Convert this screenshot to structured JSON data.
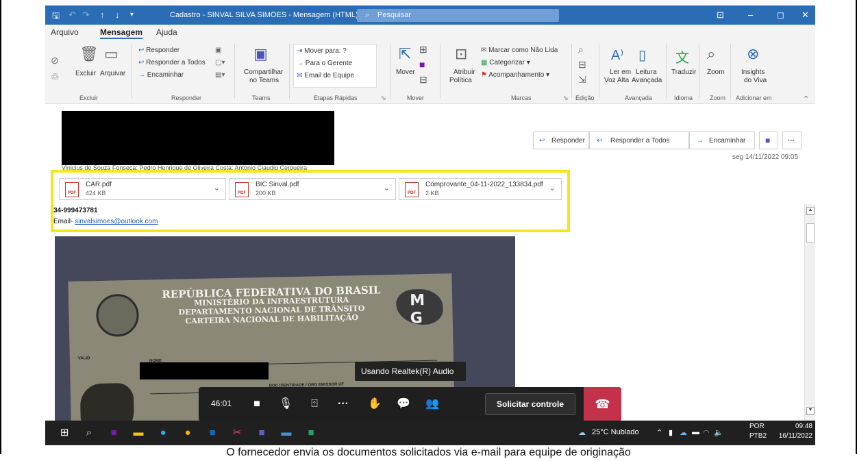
{
  "window": {
    "title": "Cadastro - SINVAL SILVA SIMOES - Mensagem (HTML)",
    "search_placeholder": "Pesquisar"
  },
  "ribbon_tabs": [
    "Arquivo",
    "Mensagem",
    "Ajuda"
  ],
  "ribbon": {
    "excluir": {
      "excluir": "Excluir",
      "arquivar": "Arquivar",
      "group": "Excluir"
    },
    "responder": {
      "responder": "Responder",
      "responder_todos": "Responder a Todos",
      "encaminhar": "Encaminhar",
      "group": "Responder"
    },
    "teams": {
      "compartilhar": "Compartilhar",
      "no_teams": "no Teams",
      "group": "Teams"
    },
    "etapas": {
      "mover_para": "Mover para: ?",
      "para_gerente": "Para o Gerente",
      "email_equipe": "Email de Equipe",
      "group": "Etapas Rápidas"
    },
    "mover": {
      "mover": "Mover",
      "group": "Mover"
    },
    "marcas": {
      "atribuir": "Atribuir",
      "politica": "Política",
      "marcar_nao_lida": "Marcar como Não Lida",
      "categorizar": "Categorizar",
      "acompanhamento": "Acompanhamento",
      "group": "Marcas"
    },
    "edicao": {
      "group": "Edição"
    },
    "avancada": {
      "ler_em": "Ler em",
      "voz_alta": "Voz Alta",
      "leitura": "Leitura",
      "avancada": "Avançada",
      "group": "Avançada"
    },
    "idioma": {
      "traduzir": "Traduzir",
      "group": "Idioma"
    },
    "zoom": {
      "zoom": "Zoom",
      "group": "Zoom"
    },
    "viva": {
      "insights": "Insights",
      "do_viva": "do Viva",
      "group": "Adicionar em"
    }
  },
  "message": {
    "from_line": "Vinicius de Souza Fonseca; Pedro Henrique de Oliveira Costa; Antonio Claudio Cerqueira",
    "actions": {
      "responder": "Responder",
      "responder_todos": "Responder a Todos",
      "encaminhar": "Encaminhar",
      "more": "···"
    },
    "date": "seg 14/11/2022 09:05",
    "attachments": [
      {
        "name": "CAR.pdf",
        "size": "424 KB"
      },
      {
        "name": "BIC Sinval.pdf",
        "size": "200 KB"
      },
      {
        "name": "Comprovante_04-11-2022_133834.pdf",
        "size": "2 KB"
      }
    ],
    "pdf_label": "PDF",
    "phone": "34-999473781",
    "email_label": "Email- ",
    "email": "sinvalsimoes@outlook.com"
  },
  "document_photo": {
    "header_lines": [
      "REPÚBLICA FEDERATIVA DO BRASIL",
      "MINISTÉRIO DA INFRAESTRUTURA",
      "DEPARTAMENTO NACIONAL DE TRÂNSITO",
      "CARTEIRA NACIONAL DE HABILITAÇÃO"
    ],
    "state_m": "M",
    "state_g": "G",
    "field_valid": "VALID",
    "field_nome": "NOME",
    "field_doc": "DOC IDENTIDADE / ORG EMISSOR UF"
  },
  "tooltip": "Usando Realtek(R) Audio",
  "call": {
    "timer": "46:01",
    "request_control": "Solicitar controle"
  },
  "taskbar": {
    "weather": "25°C Nublado",
    "lang_top": "POR",
    "lang_bottom": "PTB2",
    "time": "09:48",
    "date": "16/11/2022"
  },
  "caption": "O fornecedor envia os documentos solicitados via e-mail para equipe de originação",
  "colors": {
    "titlebar": "#2b6db5",
    "highlight": "#f7e51b",
    "hangup": "#c4314b"
  }
}
